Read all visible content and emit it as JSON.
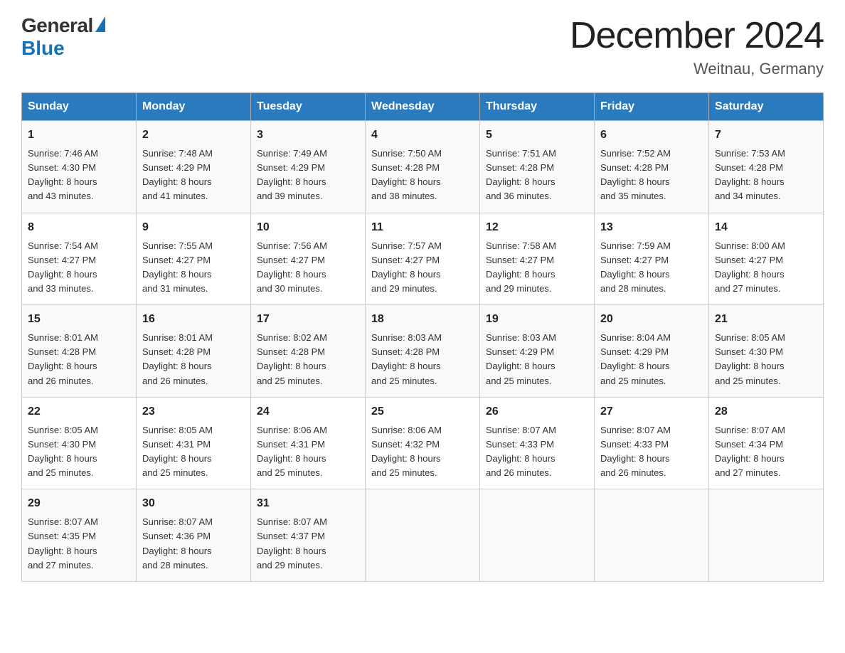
{
  "header": {
    "logo_general": "General",
    "logo_blue": "Blue",
    "title": "December 2024",
    "subtitle": "Weitnau, Germany"
  },
  "days_of_week": [
    "Sunday",
    "Monday",
    "Tuesday",
    "Wednesday",
    "Thursday",
    "Friday",
    "Saturday"
  ],
  "weeks": [
    [
      {
        "day": "1",
        "sunrise": "7:46 AM",
        "sunset": "4:30 PM",
        "daylight": "8 hours and 43 minutes."
      },
      {
        "day": "2",
        "sunrise": "7:48 AM",
        "sunset": "4:29 PM",
        "daylight": "8 hours and 41 minutes."
      },
      {
        "day": "3",
        "sunrise": "7:49 AM",
        "sunset": "4:29 PM",
        "daylight": "8 hours and 39 minutes."
      },
      {
        "day": "4",
        "sunrise": "7:50 AM",
        "sunset": "4:28 PM",
        "daylight": "8 hours and 38 minutes."
      },
      {
        "day": "5",
        "sunrise": "7:51 AM",
        "sunset": "4:28 PM",
        "daylight": "8 hours and 36 minutes."
      },
      {
        "day": "6",
        "sunrise": "7:52 AM",
        "sunset": "4:28 PM",
        "daylight": "8 hours and 35 minutes."
      },
      {
        "day": "7",
        "sunrise": "7:53 AM",
        "sunset": "4:28 PM",
        "daylight": "8 hours and 34 minutes."
      }
    ],
    [
      {
        "day": "8",
        "sunrise": "7:54 AM",
        "sunset": "4:27 PM",
        "daylight": "8 hours and 33 minutes."
      },
      {
        "day": "9",
        "sunrise": "7:55 AM",
        "sunset": "4:27 PM",
        "daylight": "8 hours and 31 minutes."
      },
      {
        "day": "10",
        "sunrise": "7:56 AM",
        "sunset": "4:27 PM",
        "daylight": "8 hours and 30 minutes."
      },
      {
        "day": "11",
        "sunrise": "7:57 AM",
        "sunset": "4:27 PM",
        "daylight": "8 hours and 29 minutes."
      },
      {
        "day": "12",
        "sunrise": "7:58 AM",
        "sunset": "4:27 PM",
        "daylight": "8 hours and 29 minutes."
      },
      {
        "day": "13",
        "sunrise": "7:59 AM",
        "sunset": "4:27 PM",
        "daylight": "8 hours and 28 minutes."
      },
      {
        "day": "14",
        "sunrise": "8:00 AM",
        "sunset": "4:27 PM",
        "daylight": "8 hours and 27 minutes."
      }
    ],
    [
      {
        "day": "15",
        "sunrise": "8:01 AM",
        "sunset": "4:28 PM",
        "daylight": "8 hours and 26 minutes."
      },
      {
        "day": "16",
        "sunrise": "8:01 AM",
        "sunset": "4:28 PM",
        "daylight": "8 hours and 26 minutes."
      },
      {
        "day": "17",
        "sunrise": "8:02 AM",
        "sunset": "4:28 PM",
        "daylight": "8 hours and 25 minutes."
      },
      {
        "day": "18",
        "sunrise": "8:03 AM",
        "sunset": "4:28 PM",
        "daylight": "8 hours and 25 minutes."
      },
      {
        "day": "19",
        "sunrise": "8:03 AM",
        "sunset": "4:29 PM",
        "daylight": "8 hours and 25 minutes."
      },
      {
        "day": "20",
        "sunrise": "8:04 AM",
        "sunset": "4:29 PM",
        "daylight": "8 hours and 25 minutes."
      },
      {
        "day": "21",
        "sunrise": "8:05 AM",
        "sunset": "4:30 PM",
        "daylight": "8 hours and 25 minutes."
      }
    ],
    [
      {
        "day": "22",
        "sunrise": "8:05 AM",
        "sunset": "4:30 PM",
        "daylight": "8 hours and 25 minutes."
      },
      {
        "day": "23",
        "sunrise": "8:05 AM",
        "sunset": "4:31 PM",
        "daylight": "8 hours and 25 minutes."
      },
      {
        "day": "24",
        "sunrise": "8:06 AM",
        "sunset": "4:31 PM",
        "daylight": "8 hours and 25 minutes."
      },
      {
        "day": "25",
        "sunrise": "8:06 AM",
        "sunset": "4:32 PM",
        "daylight": "8 hours and 25 minutes."
      },
      {
        "day": "26",
        "sunrise": "8:07 AM",
        "sunset": "4:33 PM",
        "daylight": "8 hours and 26 minutes."
      },
      {
        "day": "27",
        "sunrise": "8:07 AM",
        "sunset": "4:33 PM",
        "daylight": "8 hours and 26 minutes."
      },
      {
        "day": "28",
        "sunrise": "8:07 AM",
        "sunset": "4:34 PM",
        "daylight": "8 hours and 27 minutes."
      }
    ],
    [
      {
        "day": "29",
        "sunrise": "8:07 AM",
        "sunset": "4:35 PM",
        "daylight": "8 hours and 27 minutes."
      },
      {
        "day": "30",
        "sunrise": "8:07 AM",
        "sunset": "4:36 PM",
        "daylight": "8 hours and 28 minutes."
      },
      {
        "day": "31",
        "sunrise": "8:07 AM",
        "sunset": "4:37 PM",
        "daylight": "8 hours and 29 minutes."
      },
      null,
      null,
      null,
      null
    ]
  ],
  "labels": {
    "sunrise": "Sunrise:",
    "sunset": "Sunset:",
    "daylight": "Daylight:"
  }
}
